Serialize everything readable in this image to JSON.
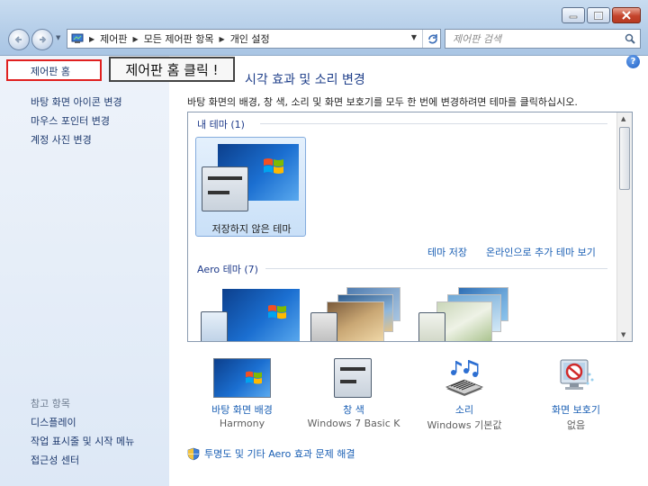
{
  "window": {
    "breadcrumb": [
      "제어판",
      "모든 제어판 항목",
      "개인 설정"
    ],
    "search_placeholder": "제어판 검색"
  },
  "left_pane": {
    "home_link": "제어판 홈",
    "callout": "제어판 홈 클릭 !",
    "links": [
      "바탕 화면 아이콘 변경",
      "마우스 포인터 변경",
      "계정 사진 변경"
    ],
    "see_also_title": "참고 항목",
    "see_also": [
      "디스플레이",
      "작업 표시줄 및 시작 메뉴",
      "접근성 센터"
    ]
  },
  "main": {
    "title": "시각 효과 및 소리 변경",
    "description": "바탕 화면의 배경, 창 색, 소리 및 화면 보호기를 모두 한 번에 변경하려면 테마를 클릭하십시오.",
    "my_themes_label": "내 테마 (1)",
    "unsaved_theme": "저장하지 않은 테마",
    "save_theme": "테마 저장",
    "online_themes": "온라인으로 추가 테마 보기",
    "aero_label": "Aero 테마 (7)",
    "help": "?"
  },
  "bottom": {
    "items": [
      {
        "label": "바탕 화면 배경",
        "sub": "Harmony",
        "icon": "desktop-background-icon"
      },
      {
        "label": "창 색",
        "sub": "Windows 7 Basic K",
        "icon": "window-color-icon"
      },
      {
        "label": "소리",
        "sub": "Windows 기본값",
        "icon": "sound-icon"
      },
      {
        "label": "화면 보호기",
        "sub": "없음",
        "icon": "screensaver-icon"
      }
    ],
    "troubleshoot": "투명도 및 기타 Aero 효과 문제 해결"
  },
  "colors": {
    "link": "#1a5fb4",
    "title": "#1f3f8a",
    "highlight_box": "#e02020"
  }
}
